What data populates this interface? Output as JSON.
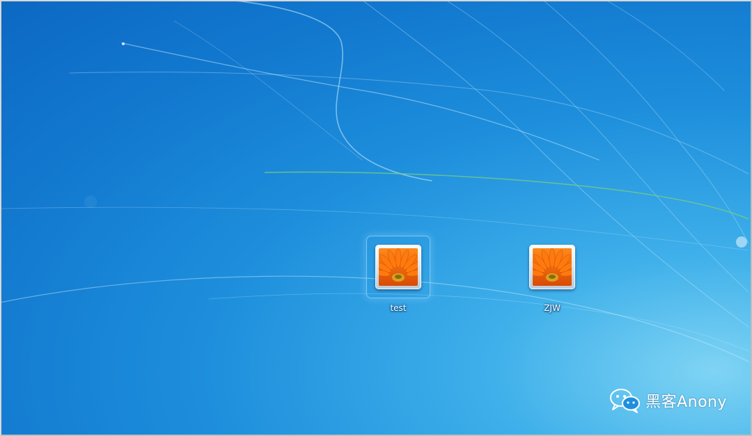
{
  "desktop": {
    "users": [
      {
        "name": "test",
        "selected": true,
        "picture_icon": "flower-icon"
      },
      {
        "name": "ZJW",
        "selected": false,
        "picture_icon": "flower-icon"
      }
    ]
  },
  "watermark": {
    "icon": "wechat-icon",
    "text": "黑客Anony"
  },
  "colors": {
    "background": "#1a86d8",
    "background_light": "#7fd4f4",
    "flower_orange": "#f26a10",
    "flower_center": "#e8b020"
  }
}
